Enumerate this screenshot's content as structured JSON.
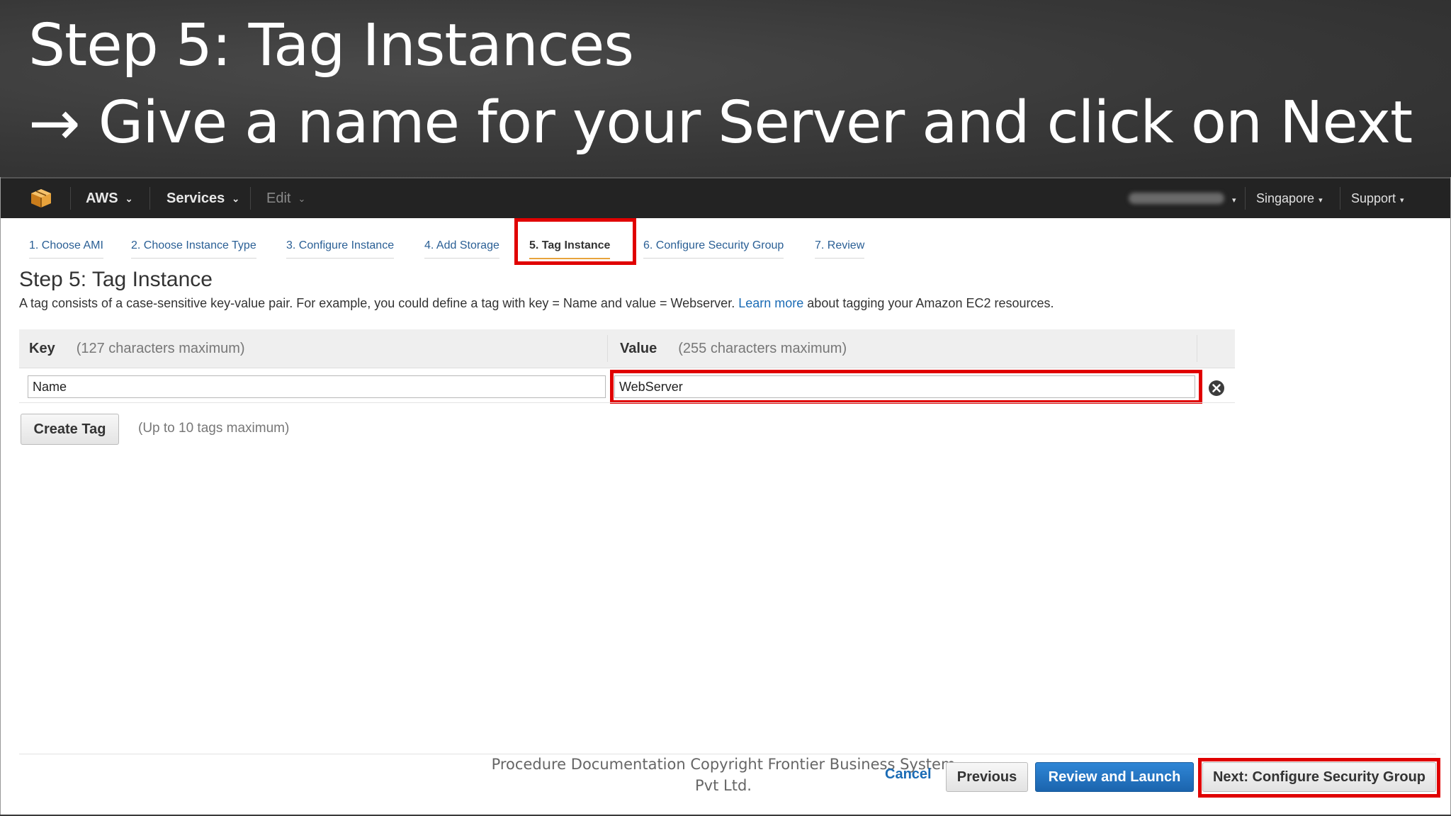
{
  "slide": {
    "title": "Step 5: Tag Instances",
    "subtitle_arrow": "→",
    "subtitle": "Give a name for your Server and click on Next"
  },
  "navbar": {
    "logo_icon": "aws-cube-icon",
    "aws_label": "AWS",
    "services_label": "Services",
    "edit_label": "Edit",
    "region_label": "Singapore",
    "support_label": "Support",
    "caret": "⌄",
    "small_caret": "▾"
  },
  "wizard_tabs": [
    {
      "label": "1. Choose AMI"
    },
    {
      "label": "2. Choose Instance Type"
    },
    {
      "label": "3. Configure Instance"
    },
    {
      "label": "4. Add Storage"
    },
    {
      "label": "5. Tag Instance",
      "active": true
    },
    {
      "label": "6. Configure Security Group"
    },
    {
      "label": "7. Review"
    }
  ],
  "page": {
    "title": "Step 5: Tag Instance",
    "desc_before": "A tag consists of a case-sensitive key-value pair. For example, you could define a tag with key = Name and value = Webserver.",
    "learn_more": "Learn more",
    "desc_after": "about tagging your Amazon EC2 resources."
  },
  "table": {
    "key_header": "Key",
    "key_hint": "(127 characters maximum)",
    "value_header": "Value",
    "value_hint": "(255 characters maximum)",
    "row": {
      "key": "Name",
      "value": "WebServer"
    }
  },
  "create_tag": {
    "label": "Create Tag",
    "hint": "(Up to 10 tags maximum)"
  },
  "footer": {
    "copyright_line1": "Procedure Documentation Copyright Frontier Business System",
    "copyright_line2": "Pvt Ltd.",
    "cancel": "Cancel",
    "previous": "Previous",
    "review_launch": "Review and Launch",
    "next": "Next: Configure Security Group"
  },
  "colors": {
    "highlight": "#e00000",
    "link": "#1a6bb5",
    "primary_button": "#1b64ad",
    "aws_orange": "#e8a33c"
  }
}
